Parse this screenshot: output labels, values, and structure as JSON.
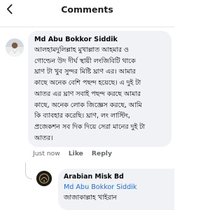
{
  "header": {
    "title": "Comments"
  },
  "comment": {
    "author": "Md Abu Bokkor Siddik",
    "lines": [
      "আলহামদুলিল্লাহ মুখাল্লাত আহমার ও",
      "গোল্ডেন উদ দীর্ঘ স্থায়ী লংজিবিটি থাকে",
      "ঘ্রাণ টা খুব সুন্দর মিষ্টি ঘ্রাণ এর। আমার",
      "কাছে অনেক বেশি পছন্দ হয়েছে। এ দুই টা",
      "আতর এর ঘ্রাণ সবাই পছন্দ করছে আমার",
      "কাছে, অনেক লোক জিজ্ঞেস করছে, আমি",
      "কি ব্যাবহার করেছি। ঘ্রাণ, লং লাস্টিং,",
      "প্রজেকশন সব দিক দিয়ে সেরা মানের দুই টা",
      "আতর।"
    ],
    "time": "Just now",
    "like_label": "Like",
    "reply_label": "Reply"
  },
  "reply": {
    "author": "Arabian Misk Bd",
    "tagged_user": "Md Abu Bokkor Siddik",
    "text": "জাজাকাল্লাহ খাইরান"
  },
  "colors": {
    "bubble": "#f0f2f5",
    "link": "#216fdb",
    "meta": "#65676b"
  },
  "icons": {
    "back": "chevron-left-icon"
  }
}
